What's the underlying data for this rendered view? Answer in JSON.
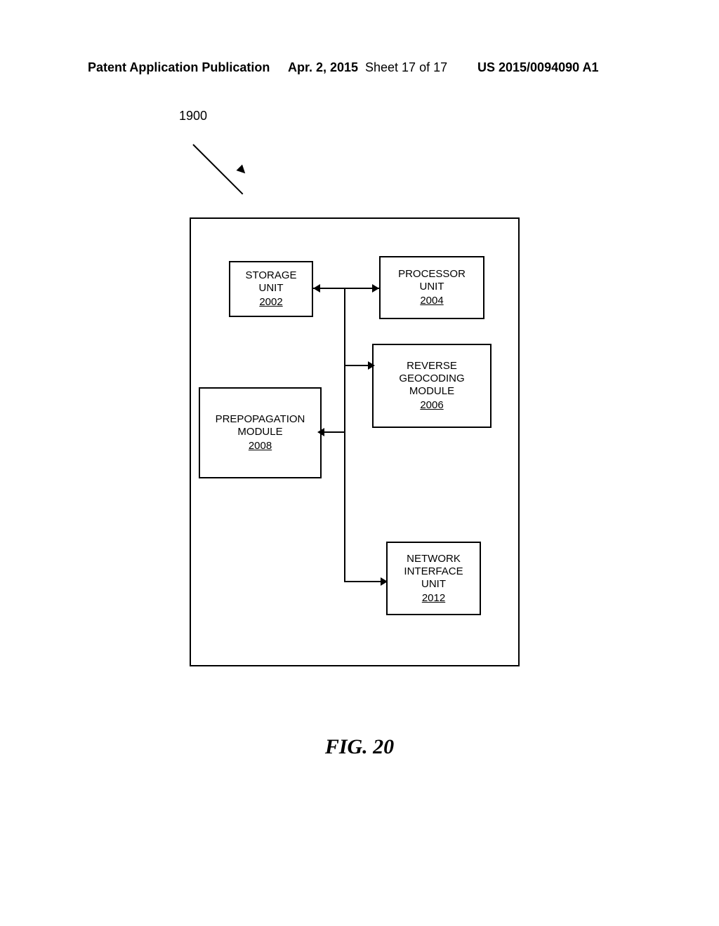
{
  "header": {
    "publication_label": "Patent Application Publication",
    "date": "Apr. 2, 2015",
    "sheet": "Sheet 17 of 17",
    "pubno": "US 2015/0094090 A1"
  },
  "diagram": {
    "ref_label": "1900",
    "blocks": {
      "storage": {
        "line1": "STORAGE",
        "line2": "UNIT",
        "num": "2002"
      },
      "processor": {
        "line1": "PROCESSOR",
        "line2": "UNIT",
        "num": "2004"
      },
      "reverse": {
        "line1": "REVERSE",
        "line2": "GEOCODING",
        "line3": "MODULE",
        "num": "2006"
      },
      "prepop": {
        "line1": "PREPOPAGATION",
        "line2": "MODULE",
        "num": "2008"
      },
      "netif": {
        "line1": "NETWORK",
        "line2": "INTERFACE",
        "line3": "UNIT",
        "num": "2012"
      }
    }
  },
  "figure_caption": "FIG. 20"
}
